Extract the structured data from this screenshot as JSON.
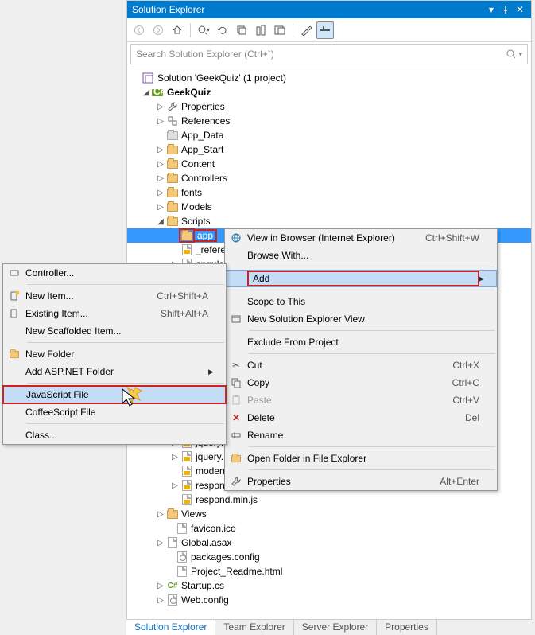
{
  "panel": {
    "title": "Solution Explorer"
  },
  "search": {
    "placeholder": "Search Solution Explorer (Ctrl+`)"
  },
  "solution": {
    "label": "Solution 'GeekQuiz' (1 project)",
    "project": "GeekQuiz",
    "nodes": {
      "properties": "Properties",
      "references": "References",
      "app_data": "App_Data",
      "app_start": "App_Start",
      "content": "Content",
      "controllers": "Controllers",
      "fonts": "fonts",
      "models": "Models",
      "scripts": "Scripts",
      "app_folder": "app",
      "views": "Views"
    },
    "scripts_children": {
      "references": "_refere",
      "angular": "angula",
      "jquery1": "jquery.",
      "jquery2": "jquery.",
      "modernizr": "moderni...  ......js",
      "respond": "respond.js",
      "respond_min": "respond.min.js"
    },
    "root_files": {
      "favicon": "favicon.ico",
      "global": "Global.asax",
      "packages": "packages.config",
      "readme": "Project_Readme.html",
      "startup": "Startup.cs",
      "web": "Web.config"
    }
  },
  "ctx1": {
    "view_browser": "View in Browser (Internet Explorer)",
    "view_browser_sh": "Ctrl+Shift+W",
    "browse_with": "Browse With...",
    "add": "Add",
    "scope": "Scope to This",
    "new_view": "New Solution Explorer View",
    "exclude": "Exclude From Project",
    "cut": "Cut",
    "cut_sh": "Ctrl+X",
    "copy": "Copy",
    "copy_sh": "Ctrl+C",
    "paste": "Paste",
    "paste_sh": "Ctrl+V",
    "delete": "Delete",
    "delete_sh": "Del",
    "rename": "Rename",
    "open_folder": "Open Folder in File Explorer",
    "properties": "Properties",
    "properties_sh": "Alt+Enter"
  },
  "ctx2": {
    "controller": "Controller...",
    "new_item": "New Item...",
    "new_item_sh": "Ctrl+Shift+A",
    "existing_item": "Existing Item...",
    "existing_item_sh": "Shift+Alt+A",
    "scaffold": "New Scaffolded Item...",
    "new_folder": "New Folder",
    "aspnet_folder": "Add ASP.NET Folder",
    "js_file": "JavaScript File",
    "coffee_file": "CoffeeScript File",
    "class": "Class..."
  },
  "tabs": {
    "solution": "Solution Explorer",
    "team": "Team Explorer",
    "server": "Server Explorer",
    "properties": "Properties"
  }
}
